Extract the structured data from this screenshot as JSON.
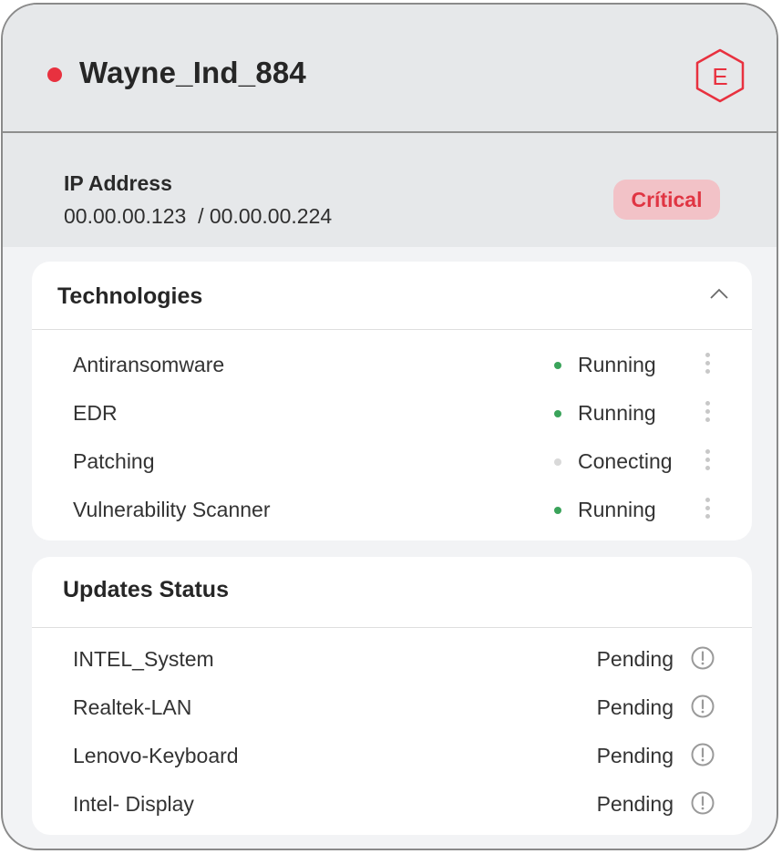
{
  "device": {
    "name": "Wayne_Ind_884",
    "status_color": "#e8313f",
    "badge_letter": "E",
    "badge_color": "#e8313f"
  },
  "ip": {
    "label": "IP Address",
    "value": "00.00.00.123  / 00.00.00.224"
  },
  "severity": {
    "label": "Crítical",
    "bg": "#f2c2c7",
    "color": "#e03543"
  },
  "technologies": {
    "title": "Technologies",
    "items": [
      {
        "name": "Antiransomware",
        "status": "Running",
        "status_color": "#3aa35a"
      },
      {
        "name": "EDR",
        "status": "Running",
        "status_color": "#3aa35a"
      },
      {
        "name": "Patching",
        "status": "Conecting",
        "status_color": "#d9d9d9"
      },
      {
        "name": "Vulnerability Scanner",
        "status": "Running",
        "status_color": "#3aa35a"
      }
    ]
  },
  "updates": {
    "title": "Updates Status",
    "items": [
      {
        "name": "INTEL_System",
        "status": "Pending"
      },
      {
        "name": "Realtek-LAN",
        "status": "Pending"
      },
      {
        "name": "Lenovo-Keyboard",
        "status": "Pending"
      },
      {
        "name": "Intel- Display",
        "status": "Pending"
      }
    ]
  }
}
